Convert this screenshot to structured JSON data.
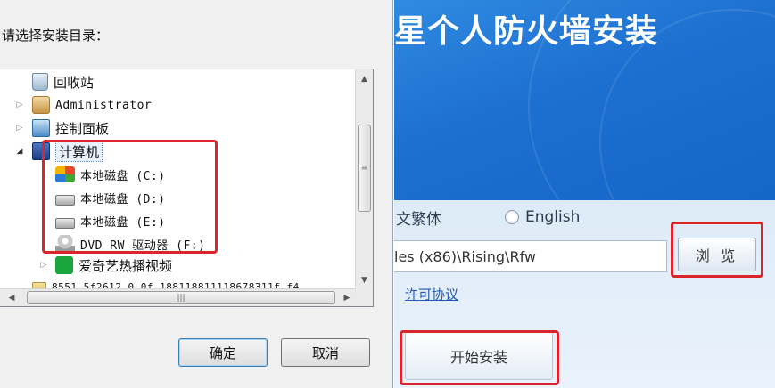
{
  "dialog": {
    "prompt": "请选择安装目录：",
    "tree": [
      {
        "label": "回收站",
        "icon": "recycle-bin-icon"
      },
      {
        "label": "Administrator",
        "icon": "user-folder-icon"
      },
      {
        "label": "控制面板",
        "icon": "control-panel-icon"
      },
      {
        "label": "计算机",
        "icon": "computer-icon",
        "selected": true
      },
      {
        "label": "本地磁盘 (C:)",
        "icon": "windows-drive-icon"
      },
      {
        "label": "本地磁盘 (D:)",
        "icon": "hard-drive-icon"
      },
      {
        "label": "本地磁盘 (E:)",
        "icon": "hard-drive-icon"
      },
      {
        "label": "DVD RW 驱动器 (F:)",
        "icon": "dvd-drive-icon"
      },
      {
        "label": "爱奇艺热播视频",
        "icon": "iqiyi-icon"
      },
      {
        "label": "8551.5f2612.0.0f.188118811118678311f.f4",
        "icon": "folder-icon"
      }
    ],
    "ok_label": "确定",
    "cancel_label": "取消"
  },
  "installer": {
    "title": "星个人防火墙安装",
    "lang_traditional": "文繁体",
    "lang_english": "English",
    "install_path": "les (x86)\\Rising\\Rfw",
    "browse_label": "浏 览",
    "license_link": "许可协议",
    "install_label": "开始安装"
  },
  "colors": {
    "annotation_red": "#d9262a",
    "banner_blue": "#1d6fd0"
  }
}
